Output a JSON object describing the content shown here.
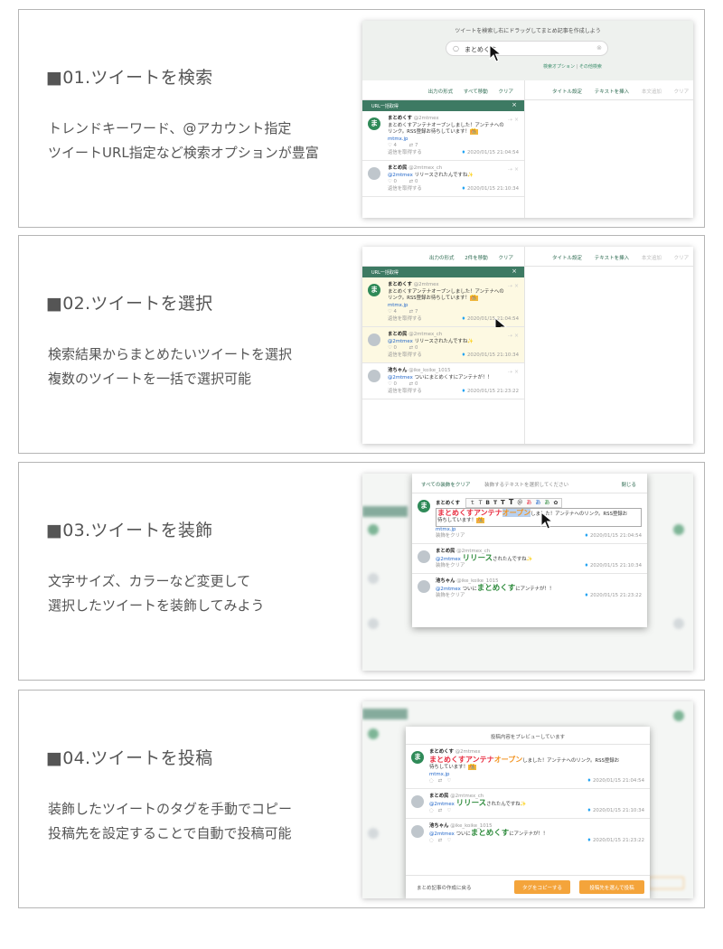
{
  "steps": [
    {
      "title": "■01.ツイートを検索",
      "desc": [
        "トレンドキーワード、@アカウント指定",
        "ツイートURL指定など検索オプションが豊富"
      ]
    },
    {
      "title": "■02.ツイートを選択",
      "desc": [
        "検索結果からまとめたいツイートを選択",
        "複数のツイートを一括で選択可能"
      ]
    },
    {
      "title": "■03.ツイートを装飾",
      "desc": [
        "文字サイズ、カラーなど変更して",
        "選択したツイートを装飾してみよう"
      ]
    },
    {
      "title": "■04.ツイートを投稿",
      "desc": [
        "装飾したツイートのタグを手動でコピー",
        "投稿先を設定することで自動で投稿可能"
      ]
    }
  ],
  "app": {
    "search_hint": "ツイートを検索し右にドラッグしてまとめ記事を作成しよう",
    "search_value": "まとめくす",
    "search_options": "検索オプション",
    "other_search": "その他検索",
    "toolbar_left": {
      "format": "出力の形式",
      "move_all": "すべて移動",
      "move_two": "2件を移動",
      "clear": "クリア"
    },
    "toolbar_right": {
      "title_setting": "タイトル設定",
      "insert_text": "テキストを挿入",
      "save_draft": "本文追加",
      "clear": "クリア"
    },
    "url_bulk": "URL一括取得",
    "reply_fetch": "返信を取得する",
    "clear_deco": "装飾をクリア",
    "tweets": [
      {
        "name": "まとめくす",
        "handle": "@2mtmex",
        "text_1": "まとめくすアンテナオープンしました！アンテナへの",
        "text_2": "リンク。RSS登録お待ちしています！",
        "emoji": "🎊",
        "link": "mtmx.jp",
        "likes": "4",
        "rt": "7",
        "date": "2020/01/15 21:04:54"
      },
      {
        "name": "まとめ民",
        "handle": "@2mtmex_ch",
        "mention": "@2mtmex",
        "text": "リリースされたんですね",
        "sparkle": "✨",
        "likes": "0",
        "rt": "0",
        "date": "2020/01/15 21:10:34"
      },
      {
        "name": "池ちゃん",
        "handle": "@ike_koike_1015",
        "mention": "@2mtmex",
        "text": "ついにまとめくすにアンテナが！！",
        "likes": "0",
        "rt": "0",
        "date": "2020/01/15 21:23:22"
      }
    ],
    "deco": {
      "clear_all": "すべての装飾をクリア",
      "instruction": "装飾するテキストを選択してください",
      "close": "閉じる",
      "fmt_buttons": [
        "ｔ",
        "T",
        "B",
        "T",
        "T",
        "T",
        "＠",
        "あ",
        "あ",
        "あ",
        "✿"
      ],
      "red_part": "まとめくすアンテナ",
      "orange_part": "オープン",
      "rest": "しました！アンテナへのリンク。RSS登録お",
      "rest2": "待ちしています！",
      "release": "リリース",
      "release_rest": "されたんですね",
      "tsuini": "ついに",
      "matome_big": "まとめくす",
      "antenna_rest": "にアンテナが！！"
    },
    "preview": {
      "title": "投稿内容をプレビューしています",
      "back": "まとめ記事の作成に戻る",
      "copy_tag": "タグをコピーする",
      "post": "投稿先を選んで投稿"
    }
  },
  "colors": {
    "brand_green": "#3d7a63",
    "accent_orange": "#f4a43b",
    "link_blue": "#1e64c8"
  }
}
